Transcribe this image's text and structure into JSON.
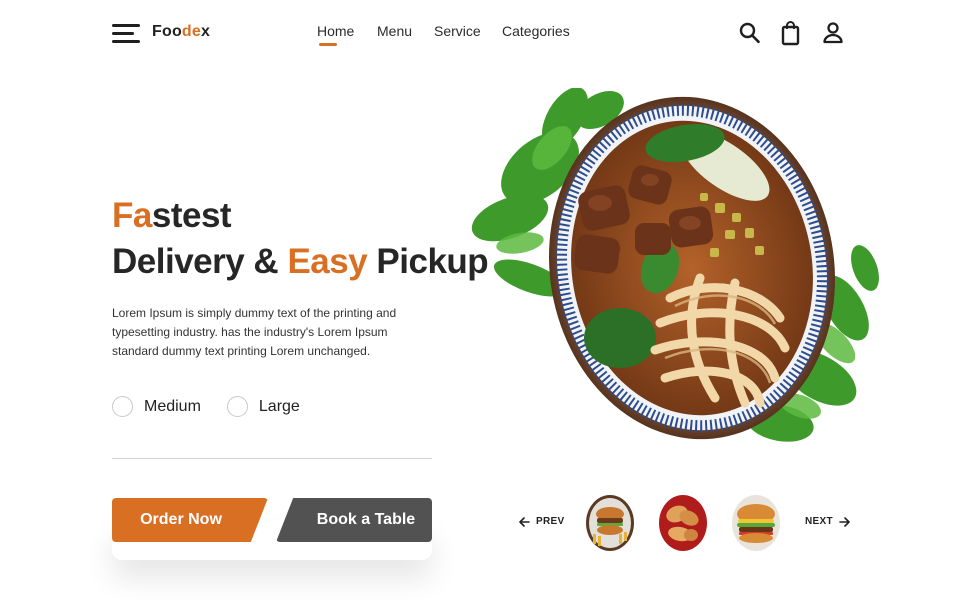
{
  "header": {
    "logo": {
      "part1": "Foo",
      "part2": "de",
      "part3": "x"
    },
    "nav": [
      "Home",
      "Menu",
      "Service",
      "Categories"
    ],
    "active_nav": "Home",
    "icons": [
      "search-icon",
      "shopping-bag-icon",
      "user-icon"
    ]
  },
  "hero": {
    "title_line1_accent": "Fa",
    "title_line1_rest": "stest",
    "title_line2_part1": "Delivery & ",
    "title_line2_accent": "Easy",
    "title_line2_part2": " Pickup",
    "description": "Lorem Ipsum is simply dummy text of the printing and typesetting industry.  has the industry's Lorem Ipsum standard dummy text printing Lorem unchanged.",
    "options": [
      {
        "label": "Medium",
        "selected": false
      },
      {
        "label": "Large",
        "selected": false
      }
    ],
    "order_button": "Order Now",
    "book_button": "Book a Table"
  },
  "carousel": {
    "prev_label": "PREV",
    "next_label": "NEXT",
    "thumbnails": [
      "burger-fries-thumbnail",
      "fried-chicken-thumbnail",
      "burger-thumbnail"
    ]
  },
  "colors": {
    "accent": "#d86f23",
    "dark_button": "#525252",
    "text": "#1f1f1f"
  }
}
